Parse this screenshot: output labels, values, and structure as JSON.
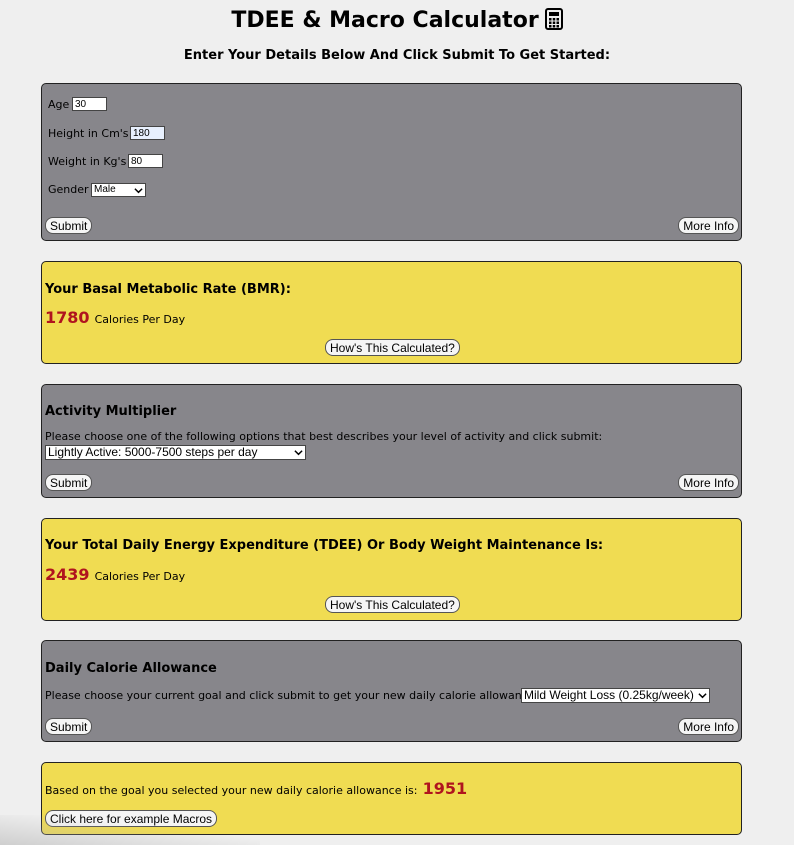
{
  "header": {
    "title": "TDEE & Macro Calculator",
    "subtitle": "Enter Your Details Below And Click Submit To Get Started:"
  },
  "details_form": {
    "age_label": "Age",
    "age_value": "30",
    "height_label": "Height in Cm's",
    "height_value": "180",
    "weight_label": "Weight in Kg's",
    "weight_value": "80",
    "gender_label": "Gender",
    "gender_value": "Male",
    "submit_label": "Submit",
    "more_info_label": "More Info"
  },
  "bmr": {
    "heading": "Your Basal Metabolic Rate (BMR):",
    "value": "1780",
    "unit": "Calories Per Day",
    "how_label": "How's This Calculated?"
  },
  "activity": {
    "heading": "Activity Multiplier",
    "prompt": "Please choose one of the following options that best describes your level of activity and click submit:",
    "selected": "Lightly Active: 5000-7500 steps per day",
    "submit_label": "Submit",
    "more_info_label": "More Info"
  },
  "tdee": {
    "heading": "Your Total Daily Energy Expenditure (TDEE) Or Body Weight Maintenance Is:",
    "value": "2439",
    "unit": "Calories Per Day",
    "how_label": "How's This Calculated?"
  },
  "allowance": {
    "heading": "Daily Calorie Allowance",
    "prompt": "Please choose your current goal and click submit to get your new daily calorie allowance:",
    "selected": "Mild Weight Loss (0.25kg/week)",
    "submit_label": "Submit",
    "more_info_label": "More Info"
  },
  "result": {
    "text": "Based on the goal you selected your new daily calorie allowance is:",
    "value": "1951",
    "macros_label": "Click here for example Macros"
  },
  "colors": {
    "background": "#efefef",
    "grey_panel": "#87868b",
    "yellow_panel": "#f0dc52",
    "accent_number": "#b0141e"
  },
  "icons": {
    "title_icon": "calculator-icon",
    "select_icon": "chevron-down-icon"
  }
}
